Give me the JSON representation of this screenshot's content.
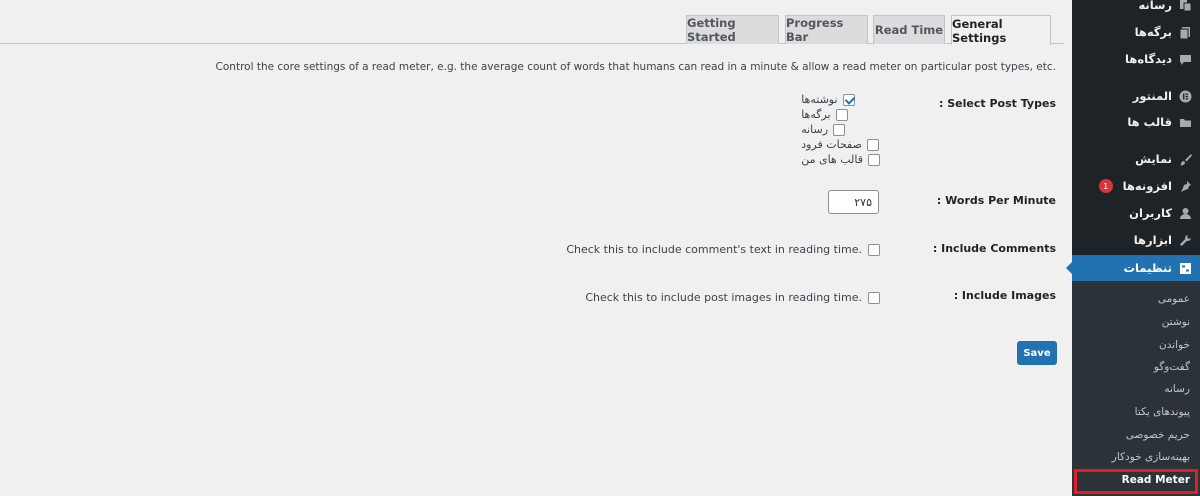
{
  "tabs": [
    {
      "label": "Getting Started",
      "active": false
    },
    {
      "label": "Progress Bar",
      "active": false
    },
    {
      "label": "Read Time",
      "active": false
    },
    {
      "label": "General Settings",
      "active": true
    }
  ],
  "description": "Control the core settings of a read meter, e.g. the average count of words that humans can read in a minute & allow a read meter on particular post types, etc.",
  "settings": {
    "post_types": {
      "label": ": Select Post Types",
      "options": [
        {
          "label": "نوشته‌ها",
          "checked": true
        },
        {
          "label": "برگه‌ها",
          "checked": false
        },
        {
          "label": "رسانه",
          "checked": false
        },
        {
          "label": "صفحات فرود",
          "checked": false
        },
        {
          "label": "قالب های من",
          "checked": false
        }
      ]
    },
    "words_per_minute": {
      "label": ": Words Per Minute",
      "value": "۲۷۵"
    },
    "include_comments": {
      "label": ": Include Comments",
      "text": "Check this to include comment's text in reading time.",
      "checked": false
    },
    "include_images": {
      "label": ": Include Images",
      "text": "Check this to include post images in reading time.",
      "checked": false
    }
  },
  "save_label": "Save",
  "sidebar": {
    "items": [
      {
        "label": "رسانه",
        "icon": "media-icon"
      },
      {
        "label": "برگه‌ها",
        "icon": "pages-icon"
      },
      {
        "label": "دیدگاه‌ها",
        "icon": "comments-icon"
      },
      {
        "label": "المنتور",
        "icon": "elementor-icon"
      },
      {
        "label": "قالب ها",
        "icon": "folder-icon"
      },
      {
        "label": "نمایش",
        "icon": "brush-icon"
      },
      {
        "label": "افزونه‌ها",
        "icon": "plugin-icon",
        "badge": "1"
      },
      {
        "label": "کاربران",
        "icon": "user-icon"
      },
      {
        "label": "ابزارها",
        "icon": "wrench-icon"
      },
      {
        "label": "تنظیمات",
        "icon": "settings-icon",
        "current": true
      }
    ],
    "submenu": [
      {
        "label": "عمومی"
      },
      {
        "label": "نوشتن"
      },
      {
        "label": "خواندن"
      },
      {
        "label": "گفت‌وگو"
      },
      {
        "label": "رسانه"
      },
      {
        "label": "پیوندهای یکتا"
      },
      {
        "label": "حریم خصوصی"
      },
      {
        "label": "بهینه‌سازی خودکار"
      },
      {
        "label": "Read Meter",
        "current": true
      }
    ]
  },
  "colors": {
    "accent": "#2271b1",
    "sidebar_bg": "#1d2327",
    "highlight": "#e01e26",
    "badge": "#d63638"
  }
}
